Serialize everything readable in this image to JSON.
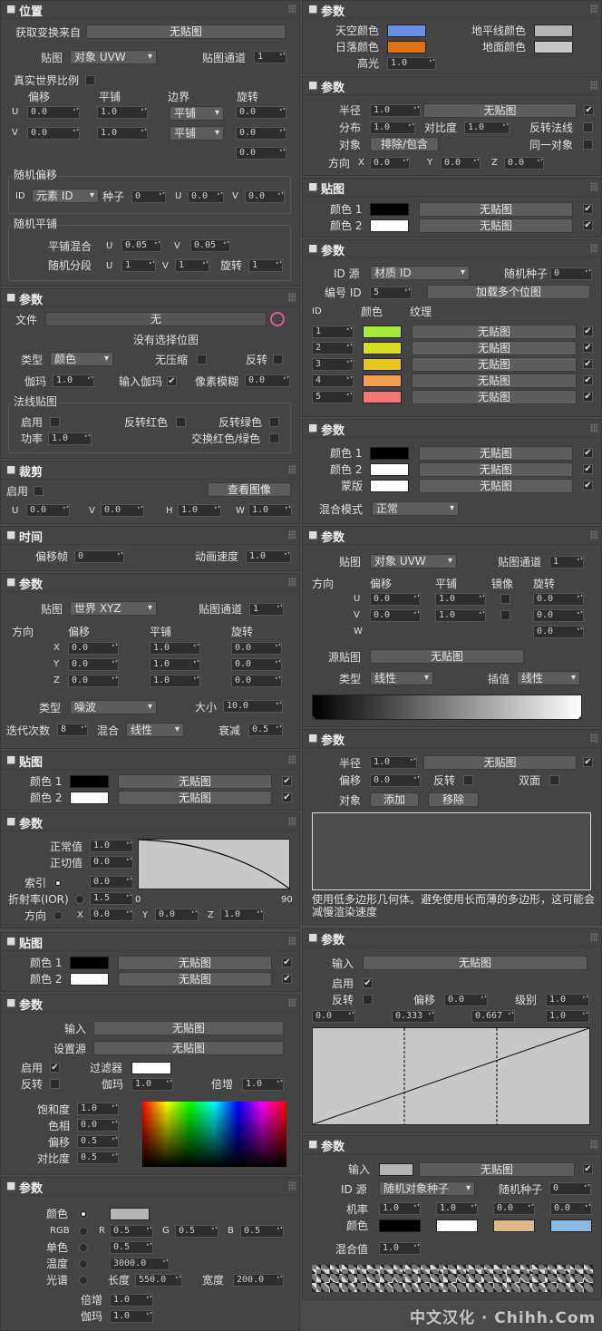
{
  "glyphs": {
    "check": "✔",
    "label_x": "X",
    "label_y": "Y",
    "label_z": "Z"
  },
  "left": {
    "pos": {
      "title": "位置",
      "get_transform": "获取变换来自",
      "btn_none": "无贴图",
      "map": "贴图",
      "map_val": "对象 UVW",
      "chan": "贴图通道",
      "chan_val": "1",
      "rwsc": "真实世界比例",
      "off": "偏移",
      "tile": "平铺",
      "bound": "边界",
      "rot": "旋转",
      "u": "U",
      "v": "V",
      "u_off": "0.0",
      "u_tile": "1.0",
      "u_bound": "平铺",
      "u_rot": "0.0",
      "v_off": "0.0",
      "v_tile": "1.0",
      "v_bound": "平铺",
      "v_rot": "0.0",
      "w_rot": "0.0",
      "rand_off": "随机偏移",
      "id": "ID",
      "id_val": "元素 ID",
      "seed": "种子",
      "seed_val": "0",
      "ru": "U",
      "ru_val": "0.0",
      "rv": "V",
      "rv_val": "0.0",
      "rand_tile": "随机平铺",
      "tile_blend": "平铺混合",
      "tb_u": "U",
      "tb_u_val": "0.05",
      "tb_v": "V",
      "tb_v_val": "0.05",
      "rand_seg": "随机分段",
      "rs_u": "U",
      "rs_u_val": "1",
      "rs_v": "V",
      "rs_v_val": "1",
      "rs_rot": "旋转",
      "rs_rot_val": "1"
    },
    "file": {
      "title": "参数",
      "file": "文件",
      "file_val": "无",
      "no_bitmap": "没有选择位图",
      "type": "类型",
      "type_val": "颜色",
      "nocomp": "无压缩",
      "invert": "反转",
      "gamma": "伽玛",
      "gamma_val": "1.0",
      "in_gamma": "输入伽玛",
      "blur": "像素模糊",
      "blur_val": "0.0",
      "normal": "法线贴图",
      "enable": "启用",
      "flip_r": "反转红色",
      "flip_g": "反转绿色",
      "power": "功率",
      "power_val": "1.0",
      "swap": "交换红色/绿色"
    },
    "crop": {
      "title": "裁剪",
      "enable": "启用",
      "view": "查看图像",
      "u": "U",
      "u_val": "0.0",
      "v": "V",
      "v_val": "0.0",
      "h": "H",
      "h_val": "1.0",
      "w": "W",
      "w_val": "1.0"
    },
    "time": {
      "title": "时间",
      "frame": "偏移帧",
      "frame_val": "0",
      "speed": "动画速度",
      "speed_val": "1.0"
    },
    "noise": {
      "title": "参数",
      "map": "贴图",
      "map_val": "世界 XYZ",
      "chan": "贴图通道",
      "chan_val": "1",
      "dir": "方向",
      "off": "偏移",
      "tile": "平铺",
      "rot": "旋转",
      "x_off": "0.0",
      "x_tile": "1.0",
      "x_rot": "0.0",
      "y_off": "0.0",
      "y_tile": "1.0",
      "y_rot": "0.0",
      "z_off": "0.0",
      "z_tile": "1.0",
      "z_rot": "0.0",
      "type": "类型",
      "type_val": "噪波",
      "size": "大小",
      "size_val": "10.0",
      "iter": "迭代次数",
      "iter_val": "8",
      "blend": "混合",
      "blend_val": "线性",
      "decay": "衰减",
      "decay_val": "0.5"
    },
    "maps1": {
      "title": "贴图",
      "c1": "颜色 1",
      "c2": "颜色 2",
      "btn": "无贴图",
      "col1": "#000000",
      "col2": "#ffffff"
    },
    "fresnel": {
      "title": "参数",
      "normal": "正常值",
      "normal_val": "1.0",
      "tangent": "正切值",
      "tangent_val": "0.0",
      "index": "索引",
      "index_val": "0.0",
      "ior": "折射率(IOR)",
      "ior_val": "1.5",
      "dir": "方向",
      "x_val": "0.0",
      "y_val": "0.0",
      "z_val": "1.0",
      "axis_min": "0",
      "axis_max": "90"
    },
    "maps2": {
      "title": "贴图",
      "c1": "颜色 1",
      "c2": "颜色 2",
      "btn": "无贴图",
      "col1": "#000000",
      "col2": "#ffffff"
    },
    "cc": {
      "title": "参数",
      "input": "输入",
      "input_btn": "无贴图",
      "src": "设置源",
      "src_btn": "无贴图",
      "enable": "启用",
      "filter": "过滤器",
      "filter_col": "#ffffff",
      "invert": "反转",
      "gamma": "伽玛",
      "gamma_val": "1.0",
      "mult": "倍增",
      "mult_val": "1.0",
      "sat": "饱和度",
      "sat_val": "1.0",
      "hue": "色相",
      "hue_val": "0.0",
      "offset": "偏移",
      "offset_val": "0.5",
      "contrast": "对比度",
      "contrast_val": "0.5"
    },
    "color": {
      "title": "参数",
      "color": "颜色",
      "color_swatch": "#b4b4b4",
      "rgb": "RGB",
      "r": "R",
      "r_val": "0.5",
      "g": "G",
      "g_val": "0.5",
      "b": "B",
      "b_val": "0.5",
      "mono": "单色",
      "mono_val": "0.5",
      "temp": "温度",
      "temp_val": "3000.0",
      "spectrum": "光谱",
      "wl": "长度",
      "wl_val": "550.0",
      "width": "宽度",
      "width_val": "200.0",
      "mult": "倍增",
      "mult_val": "1.0",
      "gamma": "伽玛",
      "gamma_val": "1.0"
    }
  },
  "right": {
    "sky": {
      "title": "参数",
      "sky": "天空颜色",
      "sky_col": "#6a8fe2",
      "horizon": "地平线颜色",
      "horizon_col": "#b4b4b4",
      "sun": "日落颜色",
      "sun_col": "#e07010",
      "ground": "地面颜色",
      "ground_col": "#c8c8c8",
      "highlight": "高光",
      "highlight_val": "1.0"
    },
    "ao": {
      "title": "参数",
      "radius": "半径",
      "radius_val": "1.0",
      "btn": "无贴图",
      "spread": "分布",
      "spread_val": "1.0",
      "contrast": "对比度",
      "contrast_val": "1.0",
      "flip": "反转法线",
      "obj": "对象",
      "excl": "排除/包含",
      "same": "同一对象",
      "dir": "方向",
      "x": "X",
      "x_val": "0.0",
      "y": "Y",
      "y_val": "0.0",
      "z": "Z",
      "z_val": "0.0"
    },
    "maps3": {
      "title": "贴图",
      "c1": "颜色 1",
      "c2": "颜色 2",
      "btn": "无贴图",
      "col1": "#000000",
      "col2": "#ffffff"
    },
    "multi": {
      "title": "参数",
      "src": "ID 源",
      "src_val": "材质 ID",
      "rseed": "随机种子",
      "rseed_val": "0",
      "num": "编号 ID",
      "num_val": "5",
      "load": "加载多个位图",
      "id_h": "ID",
      "col_h": "颜色",
      "tex_h": "纹理",
      "btn": "无贴图",
      "rows": [
        {
          "id": "1",
          "col": "#a8e840"
        },
        {
          "id": "2",
          "col": "#d6e020"
        },
        {
          "id": "3",
          "col": "#e8c820"
        },
        {
          "id": "4",
          "col": "#f0a050"
        },
        {
          "id": "5",
          "col": "#f07878"
        }
      ]
    },
    "mask": {
      "title": "参数",
      "c1": "颜色 1",
      "c2": "颜色 2",
      "mask": "蒙版",
      "btn": "无贴图",
      "col1": "#000000",
      "col2": "#ffffff",
      "col3": "#ffffff",
      "blend": "混合模式",
      "blend_val": "正常"
    },
    "grad": {
      "title": "参数",
      "map": "贴图",
      "map_val": "对象 UVW",
      "chan": "贴图通道",
      "chan_val": "1",
      "dir": "方向",
      "off": "偏移",
      "tile": "平铺",
      "mirror": "镜像",
      "rot": "旋转",
      "u": "U",
      "u_off": "0.0",
      "u_tile": "1.0",
      "u_rot": "0.0",
      "v": "V",
      "v_off": "0.0",
      "v_tile": "1.0",
      "v_rot": "0.0",
      "w": "W",
      "w_rot": "0.0",
      "src": "源贴图",
      "src_btn": "无贴图",
      "type": "类型",
      "type_val": "线性",
      "interp": "插值",
      "interp_val": "线性"
    },
    "edge": {
      "title": "参数",
      "radius": "半径",
      "radius_val": "1.0",
      "btn": "无贴图",
      "offset": "偏移",
      "offset_val": "0.0",
      "invert": "反转",
      "double": "双面",
      "obj": "对象",
      "add": "添加",
      "remove": "移除",
      "note": "使用低多边形几何体。避免使用长而薄的多边形，这可能会减慢渲染速度"
    },
    "curve": {
      "title": "参数",
      "input": "输入",
      "input_btn": "无贴图",
      "enable": "启用",
      "invert": "反转",
      "offset": "偏移",
      "offset_val": "0.0",
      "level": "级别",
      "level_val": "1.0",
      "p0": "0.0",
      "p1": "0.333",
      "p2": "0.667",
      "p3": "1.0"
    },
    "rand": {
      "title": "参数",
      "input": "输入",
      "input_col": "#b4b4b4",
      "btn": "无贴图",
      "src": "ID 源",
      "src_val": "随机对象种子",
      "rseed": "随机种子",
      "rseed_val": "0",
      "rate": "机率",
      "rate1": "1.0",
      "rate2": "1.0",
      "rate3": "0.0",
      "rate4": "0.0",
      "color": "颜色",
      "c1": "#000000",
      "c2": "#ffffff",
      "c3": "#e0b890",
      "c4": "#8ab8e0",
      "blend": "混合值",
      "blend_val": "1.0"
    }
  },
  "watermark": "中文汉化 · Chihh.Com"
}
